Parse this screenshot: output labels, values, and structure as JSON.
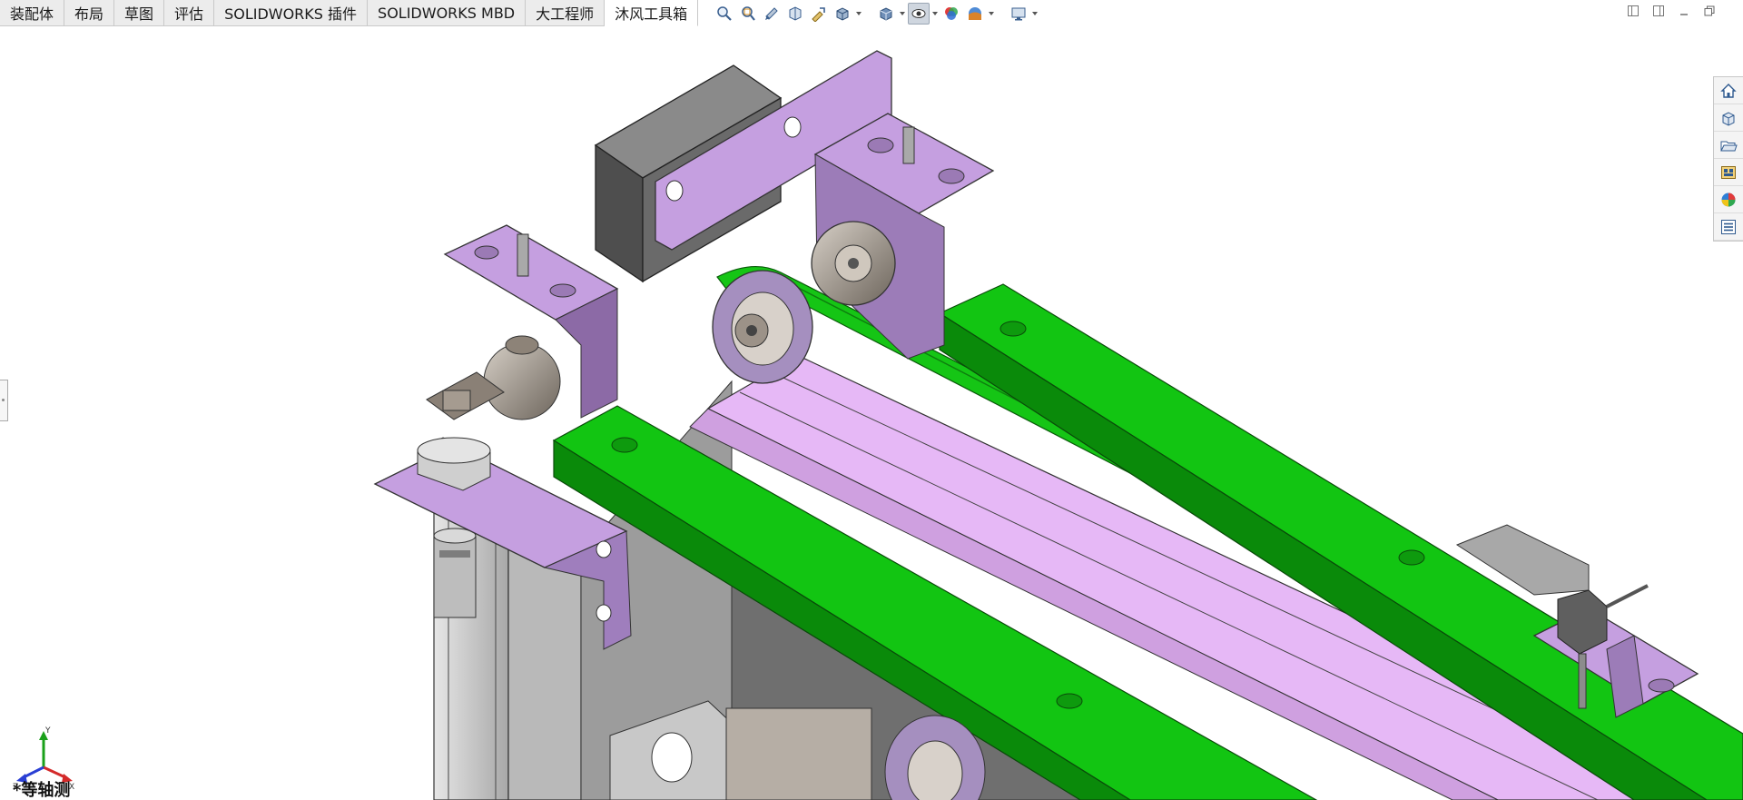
{
  "tabs": [
    {
      "label": "装配体",
      "active": false
    },
    {
      "label": "布局",
      "active": false
    },
    {
      "label": "草图",
      "active": false
    },
    {
      "label": "评估",
      "active": false
    },
    {
      "label": "SOLIDWORKS 插件",
      "active": false
    },
    {
      "label": "SOLIDWORKS MBD",
      "active": false
    },
    {
      "label": "大工程师",
      "active": false
    },
    {
      "label": "沐风工具箱",
      "active": true
    }
  ],
  "heads_up_toolbar": [
    "zoom-to-fit-icon",
    "zoom-to-area-icon",
    "previous-view-icon",
    "section-view-icon",
    "dynamic-annotation-icon",
    "view-orientation-icon",
    "display-style-icon",
    "hide-show-items-icon",
    "edit-appearance-icon",
    "apply-scene-icon",
    "view-settings-icon"
  ],
  "task_pane": [
    "solidworks-resources-icon",
    "design-library-icon",
    "file-explorer-icon",
    "view-palette-icon",
    "appearances-scenes-icon",
    "custom-properties-icon"
  ],
  "triad": {
    "x": "X",
    "y": "Y",
    "z": "Z"
  },
  "view_orientation": "*等轴测",
  "colors": {
    "guide_rail": "#12c512",
    "bracket": "#c59fe0",
    "belt_surface": "#e6b8f6",
    "frame": "#c4c4c4",
    "sensor": "#666666"
  }
}
